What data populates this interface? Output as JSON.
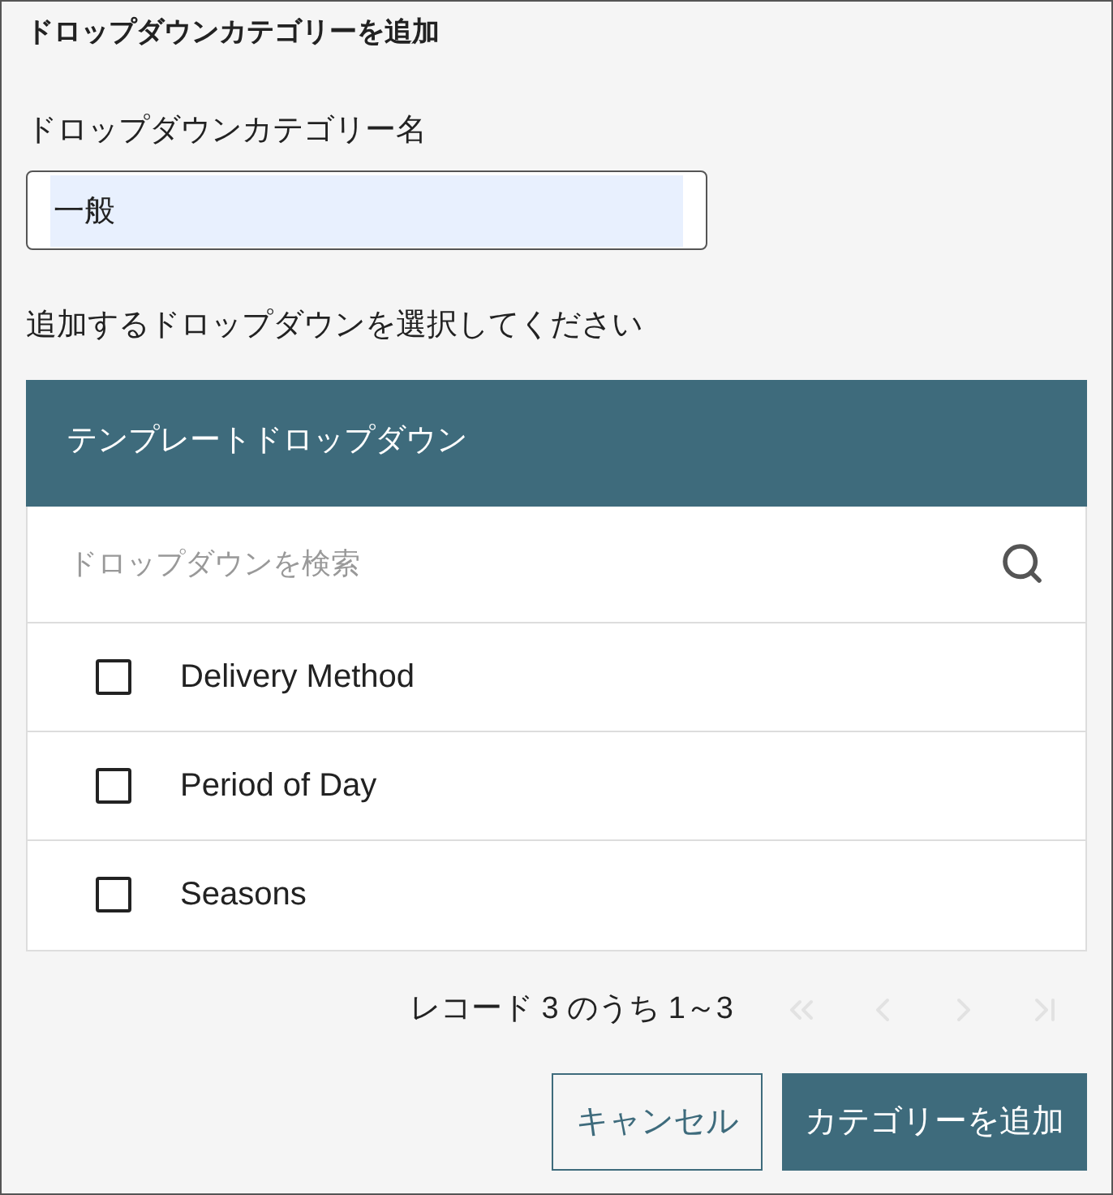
{
  "dialog": {
    "title": "ドロップダウンカテゴリーを追加"
  },
  "name_field": {
    "label": "ドロップダウンカテゴリー名",
    "value": "一般",
    "autofilled": true
  },
  "prompt": "追加するドロップダウンを選択してください",
  "table": {
    "header": "テンプレートドロップダウン",
    "search": {
      "placeholder": "ドロップダウンを検索"
    },
    "rows": [
      {
        "label": "Delivery Method",
        "checked": false
      },
      {
        "label": "Period of Day",
        "checked": false
      },
      {
        "label": "Seasons",
        "checked": false
      }
    ]
  },
  "pager": {
    "summary": "レコード 3 のうち 1～3",
    "buttons": [
      {
        "kind": "first",
        "disabled": true
      },
      {
        "kind": "prev",
        "disabled": true
      },
      {
        "kind": "next",
        "disabled": true
      },
      {
        "kind": "last",
        "disabled": true
      }
    ]
  },
  "buttons": [
    {
      "label": "キャンセル",
      "kind": "secondary"
    },
    {
      "label": "カテゴリーを追加",
      "kind": "primary"
    }
  ]
}
